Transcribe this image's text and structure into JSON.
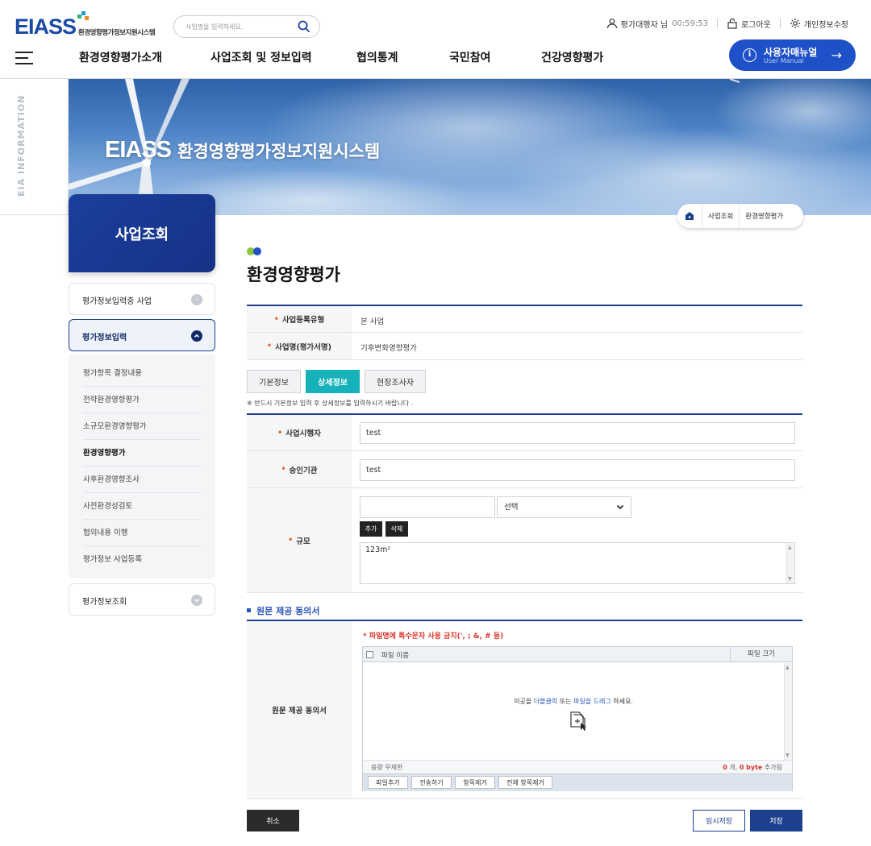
{
  "header": {
    "logo_mark": "EIASS",
    "logo_sub": "환경영향평가정보지원시스템",
    "search_placeholder": "사업명을 입력하세요.",
    "user_label": "평가대행자 님",
    "session_timer": "00:59:53",
    "logout_label": "로그아웃",
    "profile_label": "개인정보수정",
    "gnb": [
      "환경영향평가소개",
      "사업조회 및 정보입력",
      "협의통계",
      "국민참여",
      "건강영향평가"
    ],
    "manual_title": "사용자매뉴얼",
    "manual_sub": "User Manual"
  },
  "banner": {
    "rail_text": "EIA INFORMATION",
    "title_mark": "EIASS",
    "title_text": "환경영향평가정보지원시스템"
  },
  "breadcrumb": [
    "사업조회",
    "환경영향평가"
  ],
  "sidebar": {
    "title": "사업조회",
    "groups": [
      {
        "label": "평가정보입력중 사업"
      },
      {
        "label": "평가정보입력"
      },
      {
        "label": "평가정보조회"
      }
    ],
    "sub_items": [
      "평가항목 결정내용",
      "전략환경영향평가",
      "소규모환경영향평가",
      "환경영향평가",
      "사후환경영향조사",
      "사전환경성검토",
      "협의내용 이행",
      "평가정보 사업등록"
    ]
  },
  "page": {
    "title": "환경영향평가",
    "reg_type_label": "사업등록유형",
    "reg_type_value": "본 사업",
    "project_name_label": "사업명(평가서명)",
    "project_name_value": "기후변화영향평가",
    "tabs": [
      "기본정보",
      "상세정보",
      "현장조사자"
    ],
    "notice": "※ 반드시 기본정보 입력 후 상세정보를 입력하시기 바랍니다 .",
    "operator_label": "사업시행자",
    "operator_value": "test",
    "approval_label": "승인기관",
    "approval_value": "test",
    "scale_label": "규모",
    "scale_input_value": "",
    "scale_select": "선택",
    "add_label": "추가",
    "delete_label": "삭제",
    "scale_list_value": "123m²"
  },
  "upload": {
    "section_title": "원문 제공 동의서",
    "row_label": "원문 제공 동의서",
    "warning": "* 파일명에 특수문자 사용 금지(', ; &, # 등)",
    "col_name": "파일 이름",
    "col_size": "파일 크기",
    "drop_pre": "이곳을 ",
    "drop_hl1": "더블클릭",
    "drop_mid": " 또는 ",
    "drop_hl2": "파일을 드래그",
    "drop_post": " 하세요.",
    "capacity": "용량 무제한",
    "count": "0",
    "count_unit": "개,",
    "bytes": "0 byte",
    "added": "추가됨",
    "btn_add": "파일추가",
    "btn_send": "전송하기",
    "btn_remove": "항목제거",
    "btn_remove_all": "전체 항목제거"
  },
  "footer": {
    "cancel": "취소",
    "temp_save": "임시저장",
    "save": "저장"
  },
  "colors": {
    "primary": "#1c3f8e",
    "accent_blue": "#1e50c8",
    "tab_active": "#16b2ba",
    "required": "#e8622a",
    "warning": "#d9342b"
  }
}
